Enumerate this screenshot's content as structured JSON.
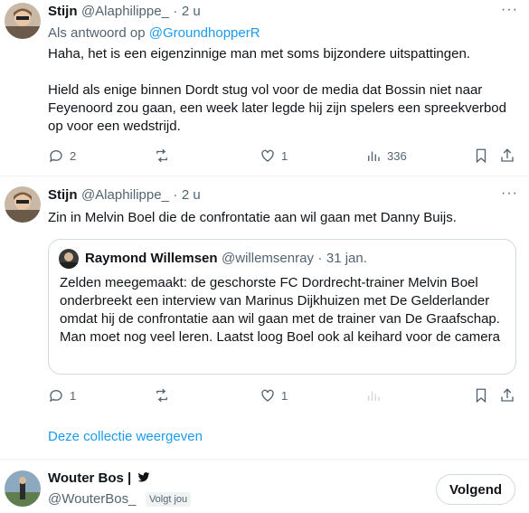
{
  "tweet1": {
    "author_name": "Stijn",
    "handle": "@Alaphilippe_",
    "separator": "·",
    "time": "2 u",
    "reply_prefix": "Als antwoord op",
    "reply_to": "@GroundhopperR",
    "para1": "Haha, het is een eigenzinnige man met soms bijzondere uitspattingen.",
    "para2": "Hield als enige binnen Dordt stug vol voor de media dat Bossin niet naar Feyenoord zou gaan, een week later legde hij zijn spelers een spreekverbod op voor een wedstrijd.",
    "replies": "2",
    "retweets": "",
    "likes": "1",
    "views": "336"
  },
  "tweet2": {
    "author_name": "Stijn",
    "handle": "@Alaphilippe_",
    "separator": "·",
    "time": "2 u",
    "text": "Zin in Melvin Boel die de confrontatie aan wil gaan met Danny Buijs.",
    "quote": {
      "author_name": "Raymond Willemsen",
      "handle": "@willemsenray",
      "separator": "·",
      "date": "31 jan.",
      "text": "Zelden meegemaakt: de geschorste FC Dordrecht-trainer Melvin Boel onderbreekt een interview van Marinus Dijkhuizen met De Gelderlander omdat hij de confrontatie aan wil gaan met de trainer van De Graafschap. Man moet nog veel leren. Laatst loog Boel ook al keihard voor de camera"
    },
    "replies": "1",
    "likes": "1"
  },
  "collection_link": "Deze collectie weergeven",
  "profile": {
    "name": "Wouter Bos |",
    "handle": "@WouterBos_",
    "follows_you": "Volgt jou",
    "follow_button": "Volgend"
  },
  "colors": {
    "accent": "#1d9bf0",
    "muted": "#536471",
    "text": "#0f1419"
  },
  "icons": [
    "more-icon",
    "reply-icon",
    "retweet-icon",
    "like-icon",
    "views-icon",
    "bookmark-icon",
    "share-icon",
    "twitter-bird-icon"
  ]
}
